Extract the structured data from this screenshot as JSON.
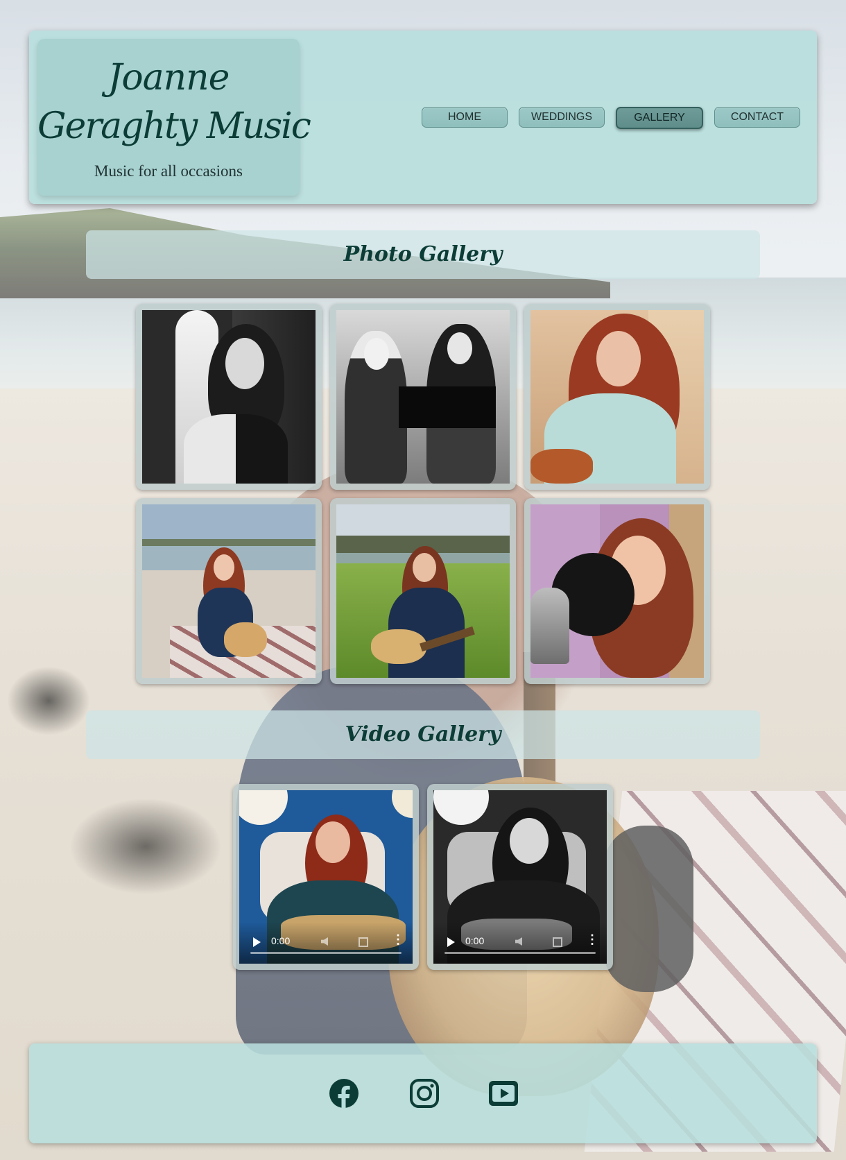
{
  "brand": {
    "name_line1": "Joanne",
    "name_line2": "Geraghty Music",
    "tagline": "Music for all occasions"
  },
  "nav": {
    "items": [
      {
        "label": "HOME",
        "active": false
      },
      {
        "label": "WEDDINGS",
        "active": false
      },
      {
        "label": "GALLERY",
        "active": true
      },
      {
        "label": "CONTACT",
        "active": false
      }
    ]
  },
  "photo_gallery": {
    "title": "Photo Gallery"
  },
  "video_gallery": {
    "title": "Video Gallery",
    "videos": [
      {
        "time": "0:00"
      },
      {
        "time": "0:00"
      }
    ]
  },
  "footer": {
    "social": [
      {
        "icon": "facebook-icon"
      },
      {
        "icon": "instagram-icon"
      },
      {
        "icon": "youtube-icon"
      }
    ]
  },
  "colors": {
    "accent": "#0c3c36",
    "panel": "#b7dedc",
    "nav_button": "#9cc9c7",
    "nav_active": "#5f8d8a"
  }
}
